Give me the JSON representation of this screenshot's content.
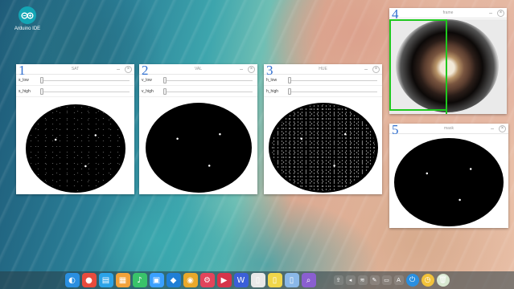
{
  "desktop": {
    "icon_label": "Arduino IDE",
    "icon_name": "arduino-ide-icon",
    "accent": "#13a6b5"
  },
  "windows": [
    {
      "number": "1",
      "title": "SAT",
      "trackbars": [
        {
          "label": "s_low"
        },
        {
          "label": "s_high"
        }
      ]
    },
    {
      "number": "2",
      "title": "VAL",
      "trackbars": [
        {
          "label": "v_low"
        },
        {
          "label": "v_high"
        }
      ]
    },
    {
      "number": "3",
      "title": "HUE",
      "trackbars": [
        {
          "label": "h_low"
        },
        {
          "label": "h_high"
        }
      ]
    },
    {
      "number": "4",
      "title": "frame"
    },
    {
      "number": "5",
      "title": "mask"
    }
  ],
  "window_controls": {
    "minimize": "–",
    "close": "×"
  },
  "taskbar": {
    "apps": [
      {
        "name": "launcher-icon",
        "glyph": "◐",
        "color": "#2a8fe0"
      },
      {
        "name": "screen-recorder-icon",
        "glyph": "●",
        "color": "#e84c3d"
      },
      {
        "name": "app-store-icon",
        "glyph": "▤",
        "color": "#2ba3e8"
      },
      {
        "name": "calendar-icon",
        "glyph": "▦",
        "color": "#f2a23a"
      },
      {
        "name": "music-icon",
        "glyph": "♪",
        "color": "#39c36a"
      },
      {
        "name": "files-icon",
        "glyph": "▣",
        "color": "#3aa0ff"
      },
      {
        "name": "store-icon",
        "glyph": "◆",
        "color": "#1f7fd6"
      },
      {
        "name": "chrome-icon",
        "glyph": "◉",
        "color": "#e9a82a"
      },
      {
        "name": "settings-icon",
        "glyph": "⚙",
        "color": "#e2455b"
      },
      {
        "name": "terminal-icon",
        "glyph": "▶",
        "color": "#d6344a"
      },
      {
        "name": "wps-writer-icon",
        "glyph": "W",
        "color": "#3b5fd8"
      },
      {
        "name": "document-icon",
        "glyph": "▯",
        "color": "#e8e8e8"
      },
      {
        "name": "document-edit-icon",
        "glyph": "▯",
        "color": "#f0d64a"
      },
      {
        "name": "document-view-icon",
        "glyph": "▯",
        "color": "#8ab8e8"
      },
      {
        "name": "search-tool-icon",
        "glyph": "⌕",
        "color": "#8a5fd0"
      }
    ],
    "tray": [
      {
        "name": "usb-icon",
        "glyph": "⇪"
      },
      {
        "name": "volume-icon",
        "glyph": "◂"
      },
      {
        "name": "network-icon",
        "glyph": "≋"
      },
      {
        "name": "pen-icon",
        "glyph": "✎"
      },
      {
        "name": "keyboard-icon",
        "glyph": "▭"
      },
      {
        "name": "language-icon",
        "glyph": "A"
      },
      {
        "name": "power-icon",
        "glyph": "⏻",
        "color": "#2a8fe0"
      },
      {
        "name": "clock-icon",
        "glyph": "◷",
        "color": "#f2c23a"
      },
      {
        "name": "trash-icon",
        "glyph": "🗑",
        "color": "#d8e8d0"
      }
    ]
  }
}
